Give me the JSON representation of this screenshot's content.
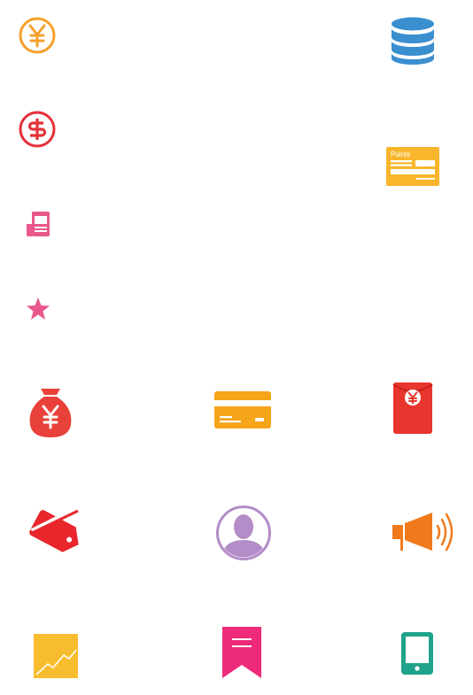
{
  "icons": [
    {
      "name": "yen-circle-icon",
      "color": "#F5A02B"
    },
    {
      "name": "database-icon",
      "color": "#3A8FCF"
    },
    {
      "name": "dollar-circle-icon",
      "color": "#E5313B"
    },
    {
      "name": "points-card-icon",
      "color": "#F8B62C",
      "label": "Points"
    },
    {
      "name": "receipt-icon",
      "color": "#E9578C"
    },
    {
      "name": "star-icon",
      "color": "#E9578C"
    },
    {
      "name": "money-bag-icon",
      "color": "#E8413A"
    },
    {
      "name": "credit-card-icon",
      "color": "#F6A418"
    },
    {
      "name": "red-envelope-icon",
      "color": "#E8352D"
    },
    {
      "name": "tag-off-icon",
      "color": "#E8262B"
    },
    {
      "name": "user-avatar-icon",
      "color": "#B48CC8"
    },
    {
      "name": "megaphone-icon",
      "color": "#F07A1C"
    },
    {
      "name": "trend-chart-icon",
      "color": "#F8BD2E"
    },
    {
      "name": "bookmark-icon",
      "color": "#EE2A7B"
    },
    {
      "name": "tablet-icon",
      "color": "#1FA38A"
    }
  ]
}
